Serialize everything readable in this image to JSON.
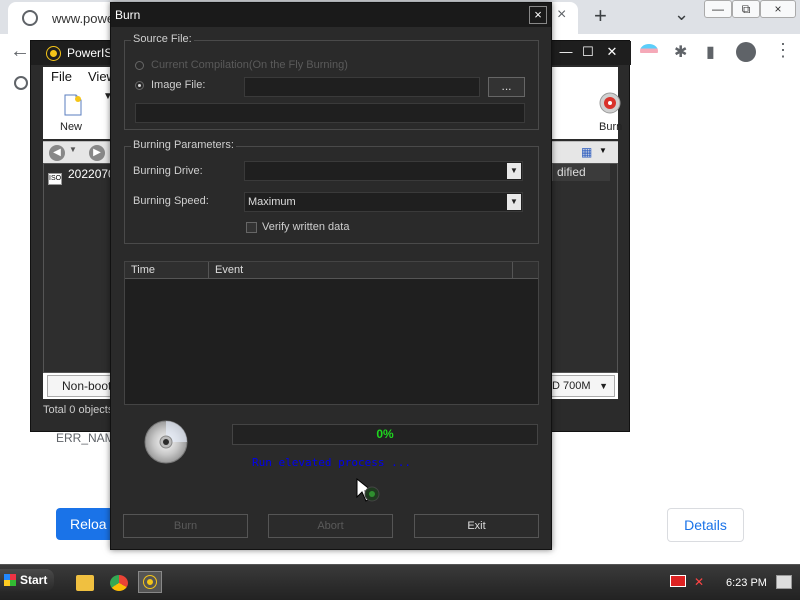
{
  "browser": {
    "url_text": "www.poweri",
    "tab_close": "×",
    "new_tab": "+",
    "tab_list": "⌄",
    "back": "←",
    "win_minimize": "—",
    "win_restore": "⧉",
    "win_close": "×",
    "error_code": "ERR_NAM",
    "reload_label": "Reloa",
    "details_label": "Details"
  },
  "poweriso": {
    "title": "PowerIS",
    "menus": [
      "File",
      "View"
    ],
    "toolbar": {
      "new_label": "New",
      "burn_label": "Burn"
    },
    "file_name": "2022070",
    "file_icon_text": "ISO",
    "column_modified": "dified",
    "boot_label": "Non-boota",
    "disc_size": "D 700M",
    "status": "Total 0 objects"
  },
  "burn_dialog": {
    "title": "Burn",
    "close": "×",
    "source_group": "Source File:",
    "option_current": "Current Compilation(On the Fly Burning)",
    "option_image": "Image File:",
    "image_value": "",
    "browse_label": "...",
    "params_group": "Burning Parameters:",
    "drive_label": "Burning Drive:",
    "drive_value": "",
    "speed_label": "Burning Speed:",
    "speed_value": "Maximum",
    "verify_label": "Verify written data",
    "verify_checked": false,
    "log_columns": [
      "Time",
      "Event"
    ],
    "progress_text": "0%",
    "progress_value": 0,
    "status_text": "Run elevated process ...",
    "buttons": {
      "burn": "Burn",
      "abort": "Abort",
      "exit": "Exit"
    }
  },
  "taskbar": {
    "start_label": "Start",
    "clock": "6:23 PM"
  },
  "colors": {
    "dialog_bg": "#2a2a2a",
    "progress_text": "#1ed81e",
    "status_link": "#0000ee",
    "chrome_accent": "#1a73e8"
  }
}
